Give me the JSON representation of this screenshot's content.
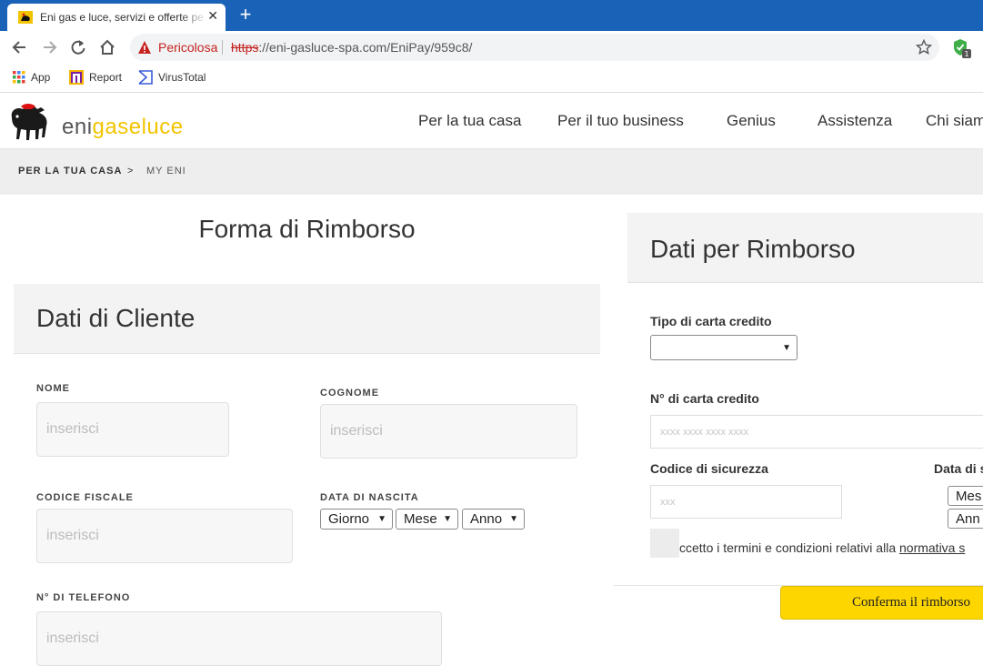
{
  "browser": {
    "tab_title": "Eni gas e luce, servizi e offerte pe",
    "security_label": "Pericolosa",
    "url_scheme": "https",
    "url_rest": "://eni-gasluce-spa.com/EniPay/959c8/",
    "bookmarks": [
      "App",
      "Report",
      "VirusTotal"
    ],
    "extension_badge": "1"
  },
  "site": {
    "logo": {
      "part1": "eni",
      "part2": "gaseluce"
    },
    "nav": [
      "Per la tua casa",
      "Per il tuo business",
      "Genius",
      "Assistenza",
      "Chi siam"
    ],
    "breadcrumb": [
      "PER LA TUA CASA",
      ">",
      "MY ENI"
    ]
  },
  "left": {
    "page_title": "Forma di Rimborso",
    "section_title": "Dati di Cliente",
    "fields": {
      "nome": {
        "label": "NOME",
        "placeholder": "inserisci"
      },
      "cognome": {
        "label": "COGNOME",
        "placeholder": "inserisci"
      },
      "codice_fiscale": {
        "label": "CODICE FISCALE",
        "placeholder": "inserisci"
      },
      "data_nascita": {
        "label": "DATA DI NASCITA",
        "giorno": "Giorno",
        "mese": "Mese",
        "anno": "Anno"
      },
      "telefono": {
        "label": "N° DI TELEFONO",
        "placeholder": "inserisci"
      }
    }
  },
  "right": {
    "section_title": "Dati per Rimborso",
    "card_type_label": "Tipo di carta credito",
    "card_number_label": "N° di carta credito",
    "card_number_placeholder": "xxxx xxxx xxxx xxxx",
    "cvv_label": "Codice di sicurezza",
    "cvv_placeholder": "xxx",
    "expiry_label": "Data di s",
    "expiry_month": "Mes",
    "expiry_year": "Ann",
    "terms_text": "ccetto i termini e condizioni relativi alla ",
    "terms_link": "normativa s",
    "confirm_button": "Conferma il rimborso"
  },
  "colors": {
    "tabbar": "#1a62b7",
    "logo_accent": "#f2c400",
    "warning": "#c5221f",
    "button": "#fdd600"
  }
}
